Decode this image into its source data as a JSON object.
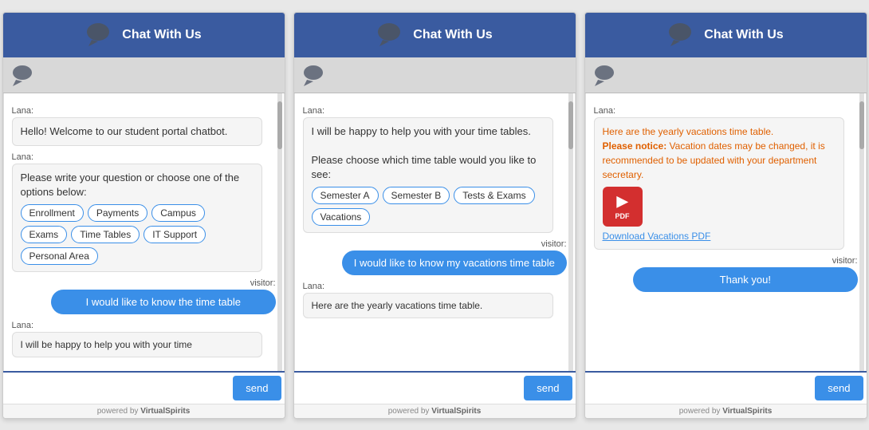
{
  "widgets": [
    {
      "id": "widget1",
      "header": {
        "title": "Chat With Us"
      },
      "messages": [
        {
          "sender": "lana",
          "sender_label": "Lana:",
          "type": "bot",
          "text": "Hello! Welcome to our student portal chatbot.",
          "options": null
        },
        {
          "sender": "lana",
          "sender_label": "Lana:",
          "type": "bot-options",
          "text": "Please write your question or choose one of the options below:",
          "options": [
            "Enrollment",
            "Payments",
            "Campus",
            "Exams",
            "Time Tables",
            "IT Support",
            "Personal Area"
          ]
        },
        {
          "sender": "visitor",
          "sender_label": "visitor:",
          "type": "visitor",
          "text": "I would like to know the time table"
        },
        {
          "sender": "lana",
          "sender_label": "Lana:",
          "type": "partial",
          "text": "I will be happy to help you with your time"
        }
      ],
      "input_placeholder": "",
      "send_label": "send",
      "powered_by": "powered by VirtualSpirits"
    },
    {
      "id": "widget2",
      "header": {
        "title": "Chat With Us"
      },
      "messages": [
        {
          "sender": "lana",
          "sender_label": "Lana:",
          "type": "bot",
          "text": "I will be happy to help you with your time tables.\n\nPlease choose which time table would you like to see:",
          "options": [
            "Semester A",
            "Semester B",
            "Tests & Exams",
            "Vacations"
          ]
        },
        {
          "sender": "visitor",
          "sender_label": "visitor:",
          "type": "visitor",
          "text": "I would like to know my vacations time table"
        },
        {
          "sender": "lana",
          "sender_label": "Lana:",
          "type": "partial",
          "text": "Here are the yearly vacations time table."
        }
      ],
      "input_placeholder": "",
      "send_label": "send",
      "powered_by": "powered by VirtualSpirits"
    },
    {
      "id": "widget3",
      "header": {
        "title": "Chat With Us"
      },
      "messages": [
        {
          "sender": "lana",
          "sender_label": "Lana:",
          "type": "bot-notice",
          "text": "Here are the yearly vacations time table.",
          "notice": "Please notice: Vacation dates may be changed, it is recommended to be updated with your department secretary.",
          "pdf_label": "Download Vacations PDF"
        },
        {
          "sender": "visitor",
          "sender_label": "visitor:",
          "type": "visitor",
          "text": "Thank you!"
        }
      ],
      "input_placeholder": "",
      "send_label": "send",
      "powered_by": "powered by VirtualSpirits"
    }
  ],
  "icons": {
    "chat_bubble": "💬",
    "pdf_icon": "PDF",
    "arrow_icon": "▶"
  }
}
